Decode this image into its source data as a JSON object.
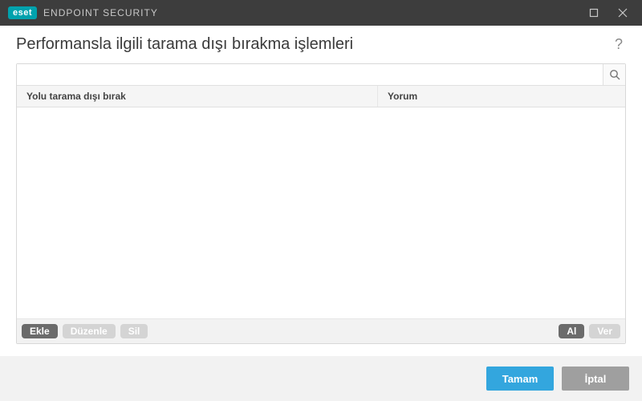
{
  "titlebar": {
    "logo": "eset",
    "app_title": "ENDPOINT SECURITY"
  },
  "header": {
    "title": "Performansla ilgili tarama dışı bırakma işlemleri",
    "help": "?"
  },
  "search": {
    "placeholder": ""
  },
  "table": {
    "columns": {
      "path": "Yolu tarama dışı bırak",
      "comment": "Yorum"
    },
    "rows": []
  },
  "actions": {
    "add": "Ekle",
    "edit": "Düzenle",
    "delete": "Sil",
    "import": "Al",
    "export": "Ver"
  },
  "footer": {
    "ok": "Tamam",
    "cancel": "İptal"
  }
}
